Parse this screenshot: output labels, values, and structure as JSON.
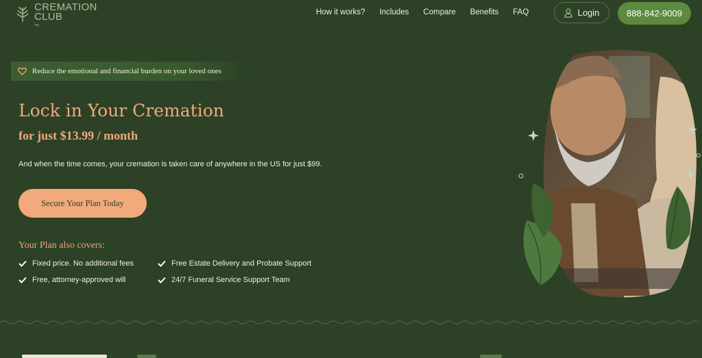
{
  "brand": {
    "line1": "CREMATION",
    "line2": "CLUB",
    "tm": "™"
  },
  "nav": {
    "items": [
      "How it works?",
      "Includes",
      "Compare",
      "Benefits",
      "FAQ"
    ],
    "login_label": "Login",
    "phone": "888-842-9009"
  },
  "hero": {
    "banner": "Reduce the emotional and financial burden on your loved ones",
    "title": "Lock in Your Cremation",
    "subtitle": "for just $13.99 / month",
    "description": "And when the time comes, your cremation is taken care of anywhere in the US for just $99.",
    "cta_label": "Secure Your Plan Today",
    "covers_title": "Your Plan also covers:",
    "features": [
      "Fixed price. No additional fees",
      "Free Estate Delivery and Probate Support",
      "Free, attorney-approved will",
      "24/7 Funeral Service Support Team"
    ]
  },
  "colors": {
    "background": "#2c4126",
    "accent": "#f1a979",
    "button_green": "#5c8a3e",
    "logo_green": "#a9c19a"
  },
  "icons": [
    "wheat-logo-icon",
    "user-icon",
    "heart-icon",
    "check-icon",
    "sparkle-icon",
    "leaf-icon"
  ]
}
